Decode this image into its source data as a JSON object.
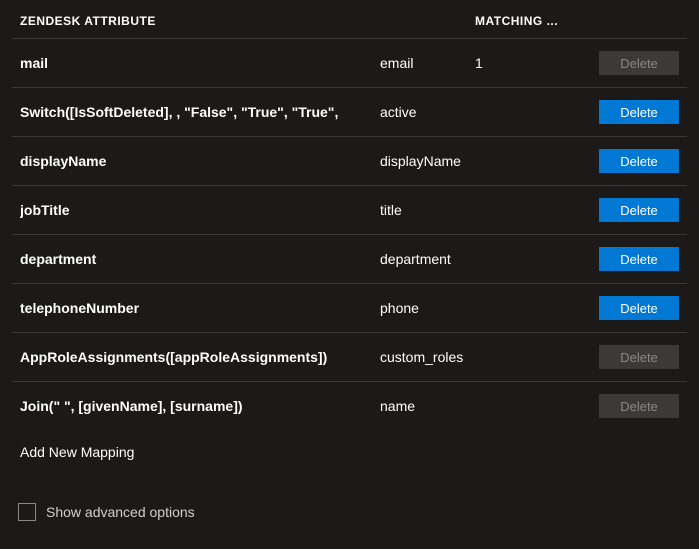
{
  "headers": {
    "source": "ZENDESK ATTRIBUTE",
    "target": "",
    "matching": "MATCHING ..."
  },
  "rows": [
    {
      "source": "mail",
      "target": "email",
      "matching": "1",
      "deleteLabel": "Delete",
      "deleteEnabled": false
    },
    {
      "source": "Switch([IsSoftDeleted], , \"False\", \"True\", \"True\",",
      "target": "active",
      "matching": "",
      "deleteLabel": "Delete",
      "deleteEnabled": true
    },
    {
      "source": "displayName",
      "target": "displayName",
      "matching": "",
      "deleteLabel": "Delete",
      "deleteEnabled": true
    },
    {
      "source": "jobTitle",
      "target": "title",
      "matching": "",
      "deleteLabel": "Delete",
      "deleteEnabled": true
    },
    {
      "source": "department",
      "target": "department",
      "matching": "",
      "deleteLabel": "Delete",
      "deleteEnabled": true
    },
    {
      "source": "telephoneNumber",
      "target": "phone",
      "matching": "",
      "deleteLabel": "Delete",
      "deleteEnabled": true
    },
    {
      "source": "AppRoleAssignments([appRoleAssignments])",
      "target": "custom_roles",
      "matching": "",
      "deleteLabel": "Delete",
      "deleteEnabled": false
    },
    {
      "source": "Join(\" \", [givenName], [surname])",
      "target": "name",
      "matching": "",
      "deleteLabel": "Delete",
      "deleteEnabled": false
    }
  ],
  "addNewLabel": "Add New Mapping",
  "footer": {
    "showAdvancedLabel": "Show advanced options",
    "checked": false
  }
}
